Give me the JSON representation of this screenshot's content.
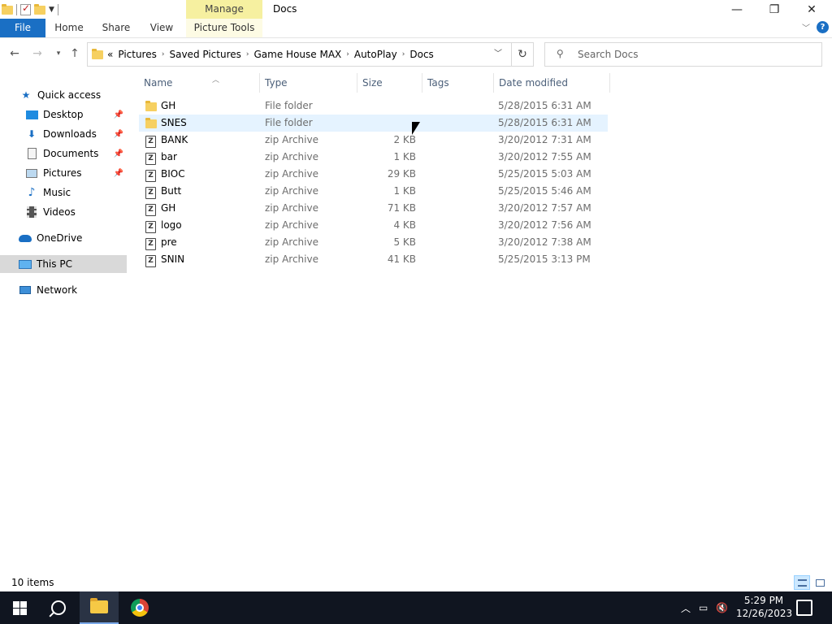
{
  "window": {
    "title": "Docs",
    "manage_label": "Manage",
    "ribbon_tabs": [
      "File",
      "Home",
      "Share",
      "View",
      "Picture Tools"
    ]
  },
  "address": {
    "overflow": "«",
    "crumbs": [
      "Pictures",
      "Saved Pictures",
      "Game House MAX",
      "AutoPlay",
      "Docs"
    ]
  },
  "search": {
    "placeholder": "Search Docs"
  },
  "nav": {
    "items": [
      {
        "label": "Quick access",
        "icon": "star-icon"
      },
      {
        "label": "Desktop",
        "icon": "desktop-icon",
        "pinned": true
      },
      {
        "label": "Downloads",
        "icon": "download-icon",
        "pinned": true
      },
      {
        "label": "Documents",
        "icon": "documents-icon",
        "pinned": true
      },
      {
        "label": "Pictures",
        "icon": "pictures-icon",
        "pinned": true
      },
      {
        "label": "Music",
        "icon": "music-icon"
      },
      {
        "label": "Videos",
        "icon": "videos-icon"
      },
      {
        "label": "OneDrive",
        "icon": "cloud-icon"
      },
      {
        "label": "This PC",
        "icon": "computer-icon",
        "selected": true
      },
      {
        "label": "Network",
        "icon": "network-icon"
      }
    ]
  },
  "columns": {
    "name": "Name",
    "type": "Type",
    "size": "Size",
    "tags": "Tags",
    "date": "Date modified"
  },
  "files": [
    {
      "name": "GH",
      "type": "File folder",
      "size": "",
      "date": "5/28/2015 6:31 AM",
      "kind": "folder"
    },
    {
      "name": "SNES",
      "type": "File folder",
      "size": "",
      "date": "5/28/2015 6:31 AM",
      "kind": "folder"
    },
    {
      "name": "BANK",
      "type": "zip Archive",
      "size": "2 KB",
      "date": "3/20/2012 7:31 AM",
      "kind": "zip"
    },
    {
      "name": "bar",
      "type": "zip Archive",
      "size": "1 KB",
      "date": "3/20/2012 7:55 AM",
      "kind": "zip"
    },
    {
      "name": "BIOC",
      "type": "zip Archive",
      "size": "29 KB",
      "date": "5/25/2015 5:03 AM",
      "kind": "zip"
    },
    {
      "name": "Butt",
      "type": "zip Archive",
      "size": "1 KB",
      "date": "5/25/2015 5:46 AM",
      "kind": "zip"
    },
    {
      "name": "GH",
      "type": "zip Archive",
      "size": "71 KB",
      "date": "3/20/2012 7:57 AM",
      "kind": "zip"
    },
    {
      "name": "logo",
      "type": "zip Archive",
      "size": "4 KB",
      "date": "3/20/2012 7:56 AM",
      "kind": "zip"
    },
    {
      "name": "pre",
      "type": "zip Archive",
      "size": "5 KB",
      "date": "3/20/2012 7:38 AM",
      "kind": "zip"
    },
    {
      "name": "SNIN",
      "type": "zip Archive",
      "size": "41 KB",
      "date": "5/25/2015 3:13 PM",
      "kind": "zip"
    }
  ],
  "status": {
    "count": "10 items"
  },
  "taskbar": {
    "time": "5:29 PM",
    "date": "12/26/2023"
  },
  "colors": {
    "accent": "#1a6fc4",
    "manage_bg": "#f6f0a0",
    "hover_row": "#e5f3ff",
    "selected_nav": "#d9d9d9",
    "taskbar": "#101520"
  }
}
